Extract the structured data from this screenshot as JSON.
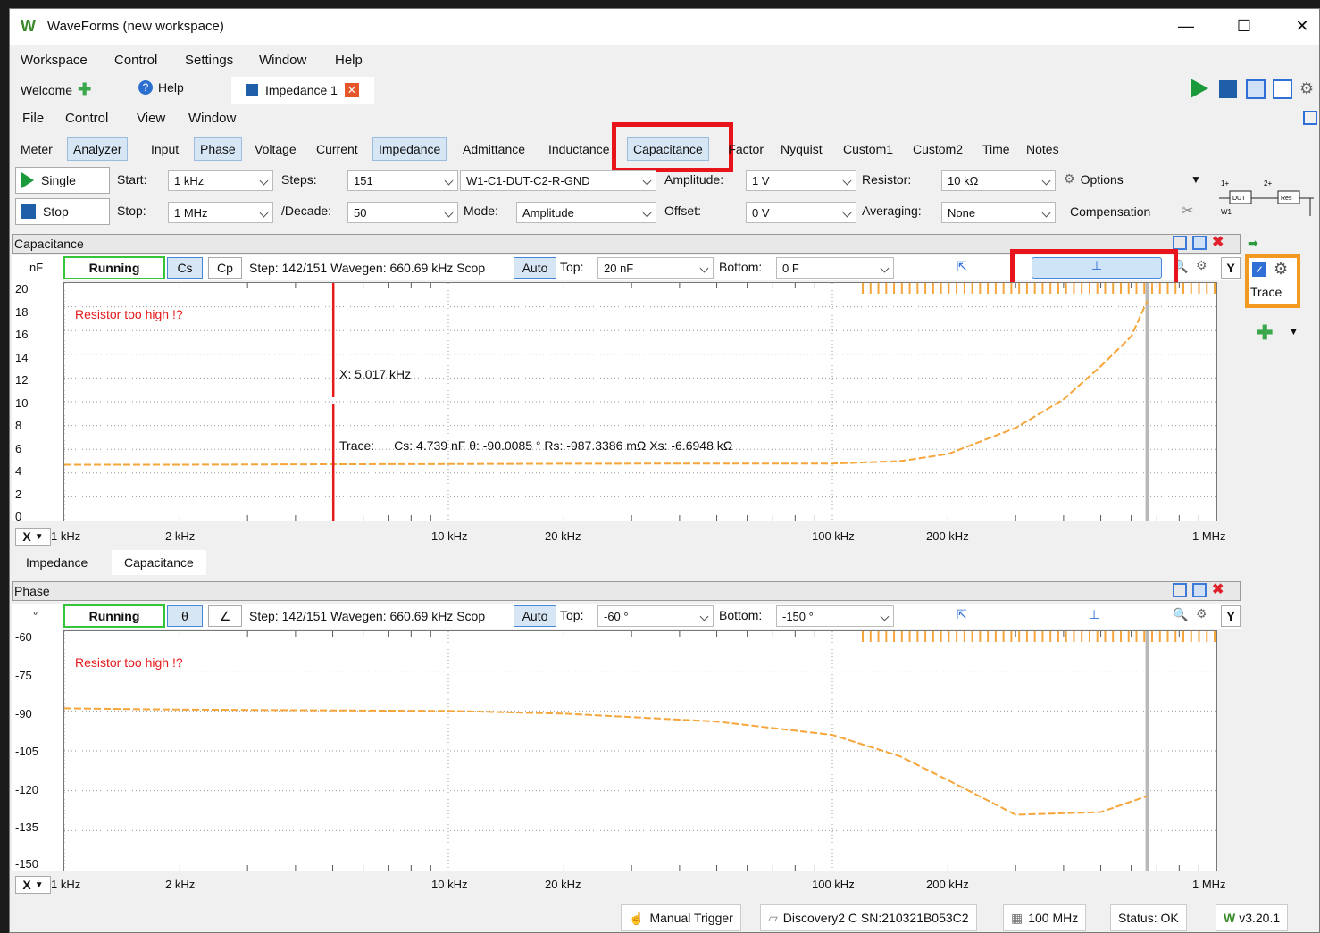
{
  "window": {
    "title": "WaveForms (new workspace)",
    "minimize": "—",
    "maximize": "☐",
    "close": "✕"
  },
  "menu": [
    "Workspace",
    "Control",
    "Settings",
    "Window",
    "Help"
  ],
  "doc_tabs": {
    "welcome": "Welcome",
    "help": "Help",
    "impedance": "Impedance 1"
  },
  "sub_menu": [
    "File",
    "Control",
    "View",
    "Window"
  ],
  "view_tabs": [
    "Meter",
    "Analyzer",
    "Input",
    "Phase",
    "Voltage",
    "Current",
    "Impedance",
    "Admittance",
    "Inductance",
    "Capacitance",
    "Factor",
    "Nyquist",
    "Custom1",
    "Custom2",
    "Time",
    "Notes"
  ],
  "view_tabs_selected": [
    "Analyzer",
    "Phase",
    "Impedance",
    "Capacitance"
  ],
  "toolbar": {
    "single": "Single",
    "stop": "Stop",
    "start_label": "Start:",
    "start_value": "1 kHz",
    "stop_label": "Stop:",
    "stop_value": "1 MHz",
    "steps_label": "Steps:",
    "steps_value": "151",
    "decade_label": "/Decade:",
    "decade_value": "50",
    "wiring_value": "W1-C1-DUT-C2-R-GND",
    "mode_label": "Mode:",
    "mode_value": "Amplitude",
    "amplitude_label": "Amplitude:",
    "amplitude_value": "1 V",
    "offset_label": "Offset:",
    "offset_value": "0 V",
    "resistor_label": "Resistor:",
    "resistor_value": "10 kΩ",
    "averaging_label": "Averaging:",
    "averaging_value": "None",
    "options": "Options",
    "compensation": "Compensation"
  },
  "capacitance_panel": {
    "title": "Capacitance",
    "unit": "nF",
    "status": "Running",
    "btn_cs": "Cs",
    "btn_cp": "Cp",
    "step_info": "Step: 142/151 Wavegen: 660.69 kHz  Scop",
    "auto": "Auto",
    "top_label": "Top:",
    "top_value": "20 nF",
    "bottom_label": "Bottom:",
    "bottom_value": "0 F",
    "y_btn": "Y",
    "x_btn": "X",
    "warning": "Resistor too high !?",
    "cursor_x": "X: 5.017 kHz",
    "trace_label": "Trace:",
    "trace_values": "Cs: 4.739 nF  θ: -90.0085 °  Rs: -987.3386 mΩ  Xs: -6.6948 kΩ",
    "y_ticks": [
      "20",
      "18",
      "16",
      "14",
      "12",
      "10",
      "8",
      "6",
      "4",
      "2",
      "0"
    ],
    "x_ticks": [
      "1 kHz",
      "2 kHz",
      "10 kHz",
      "20 kHz",
      "100 kHz",
      "200 kHz",
      "1 MHz"
    ]
  },
  "mid_tabs": [
    "Impedance",
    "Capacitance"
  ],
  "phase_panel": {
    "title": "Phase",
    "unit": "°",
    "status": "Running",
    "btn_theta": "θ",
    "btn_angle": "∠",
    "step_info": "Step: 142/151 Wavegen: 660.69 kHz  Scop",
    "auto": "Auto",
    "top_label": "Top:",
    "top_value": "-60 °",
    "bottom_label": "Bottom:",
    "bottom_value": "-150 °",
    "y_btn": "Y",
    "x_btn": "X",
    "warning": "Resistor too high !?",
    "y_ticks": [
      "-60",
      "-75",
      "-90",
      "-105",
      "-120",
      "-135",
      "-150"
    ],
    "x_ticks": [
      "1 kHz",
      "2 kHz",
      "10 kHz",
      "20 kHz",
      "100 kHz",
      "200 kHz",
      "1 MHz"
    ]
  },
  "side": {
    "trace": "Trace"
  },
  "statusbar": {
    "manual_trigger": "Manual Trigger",
    "device": "Discovery2 C SN:210321B053C2",
    "clock": "100 MHz",
    "status": "Status: OK",
    "version": "v3.20.1"
  },
  "chart_data": [
    {
      "type": "line",
      "title": "Capacitance",
      "ylabel": "nF",
      "xscale": "log",
      "xlim": [
        1000,
        1000000
      ],
      "ylim": [
        0,
        20
      ],
      "series": [
        {
          "name": "Cs",
          "color": "#f5a53a",
          "x": [
            1000,
            2000,
            5000,
            10000,
            20000,
            50000,
            100000,
            150000,
            200000,
            300000,
            400000,
            500000,
            600000,
            660690
          ],
          "y": [
            4.7,
            4.7,
            4.74,
            4.75,
            4.78,
            4.8,
            4.8,
            5.0,
            5.6,
            7.8,
            10.2,
            13.0,
            15.5,
            18.5
          ]
        }
      ]
    },
    {
      "type": "line",
      "title": "Phase",
      "ylabel": "°",
      "xscale": "log",
      "xlim": [
        1000,
        1000000
      ],
      "ylim": [
        -150,
        -60
      ],
      "series": [
        {
          "name": "θ",
          "color": "#f5a53a",
          "x": [
            1000,
            2000,
            5000,
            10000,
            20000,
            50000,
            100000,
            150000,
            200000,
            300000,
            500000,
            660690
          ],
          "y": [
            -89,
            -89.5,
            -89.8,
            -90,
            -91,
            -94,
            -99,
            -107,
            -116,
            -129,
            -128,
            -122
          ]
        }
      ]
    }
  ]
}
